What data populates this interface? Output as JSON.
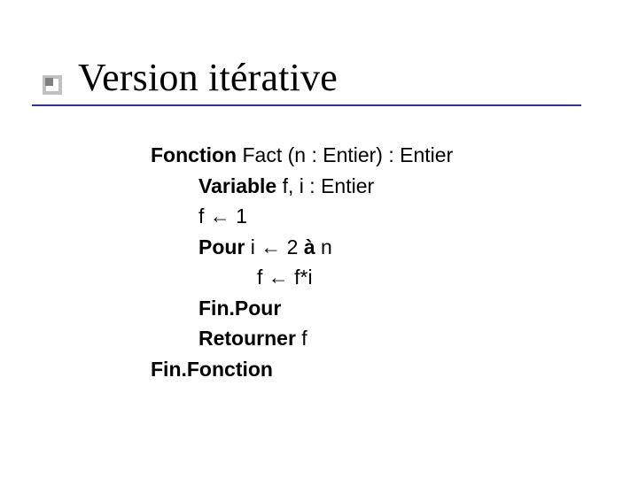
{
  "title": "Version itérative",
  "code": {
    "line1": {
      "kw": "Fonction",
      "rest": " Fact (n : Entier) : Entier"
    },
    "line2": {
      "kw": "Variable",
      "rest": " f, i : Entier"
    },
    "line3": "f ← 1",
    "line4": {
      "kw": "Pour",
      "mid": "  i ←  2 ",
      "kw2": "à",
      "end": " n"
    },
    "line5": "f ← f*i",
    "line6": "Fin.Pour",
    "line7": {
      "kw": "Retourner",
      "rest": " f"
    },
    "line8": "Fin.Fonction"
  }
}
